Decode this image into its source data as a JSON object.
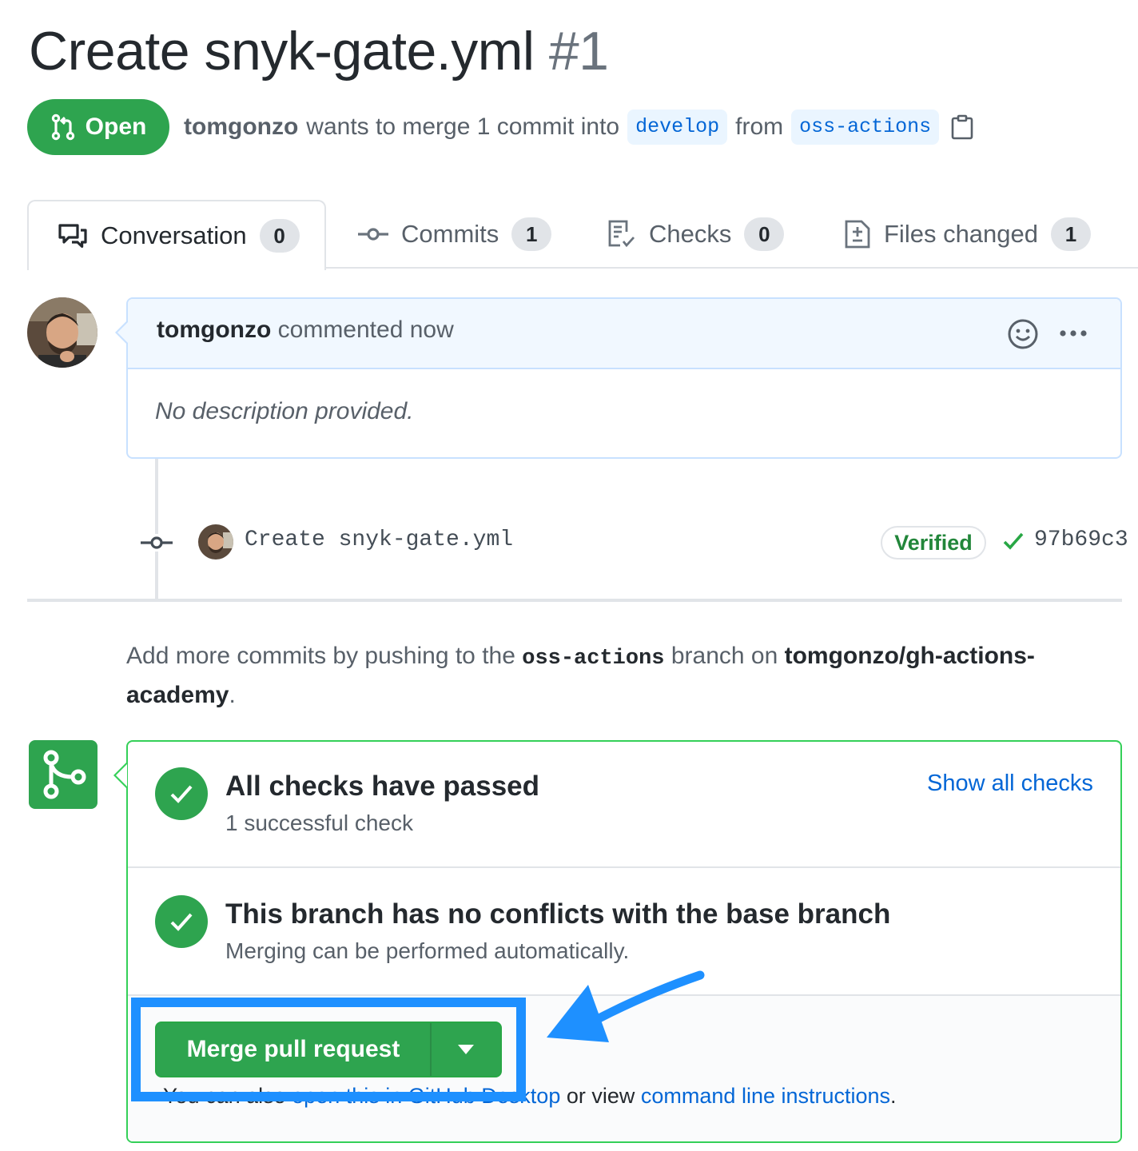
{
  "pr": {
    "title": "Create snyk-gate.yml",
    "number": "#1",
    "state": "Open",
    "author": "tomgonzo",
    "merge_text_1": "wants to merge 1 commit into",
    "base_branch": "develop",
    "from_text": "from",
    "head_branch": "oss-actions"
  },
  "tabs": [
    {
      "label": "Conversation",
      "count": "0",
      "icon": "comment-discussion-icon"
    },
    {
      "label": "Commits",
      "count": "1",
      "icon": "git-commit-icon"
    },
    {
      "label": "Checks",
      "count": "0",
      "icon": "checklist-icon"
    },
    {
      "label": "Files changed",
      "count": "1",
      "icon": "file-diff-icon"
    }
  ],
  "comment": {
    "author": "tomgonzo",
    "action": "commented now",
    "body": "No description provided."
  },
  "commit": {
    "message": "Create snyk-gate.yml",
    "verified": "Verified",
    "sha": "97b69c3"
  },
  "push_note": {
    "prefix": "Add more commits by pushing to the",
    "branch": "oss-actions",
    "middle": "branch on",
    "repo": "tomgonzo/gh-actions-academy",
    "suffix": "."
  },
  "merge": {
    "checks_title": "All checks have passed",
    "checks_sub": "1 successful check",
    "show_all": "Show all checks",
    "conflict_title": "This branch has no conflicts with the base branch",
    "conflict_sub": "Merging can be performed automatically.",
    "button": "Merge pull request",
    "hint_prefix": "You can also",
    "hint_link1": "open this in GitHub Desktop",
    "hint_middle": "or view",
    "hint_link2": "command line instructions",
    "hint_suffix": "."
  },
  "colors": {
    "success": "#2ea44f",
    "link": "#0366d6",
    "annotation": "#1e90ff"
  }
}
